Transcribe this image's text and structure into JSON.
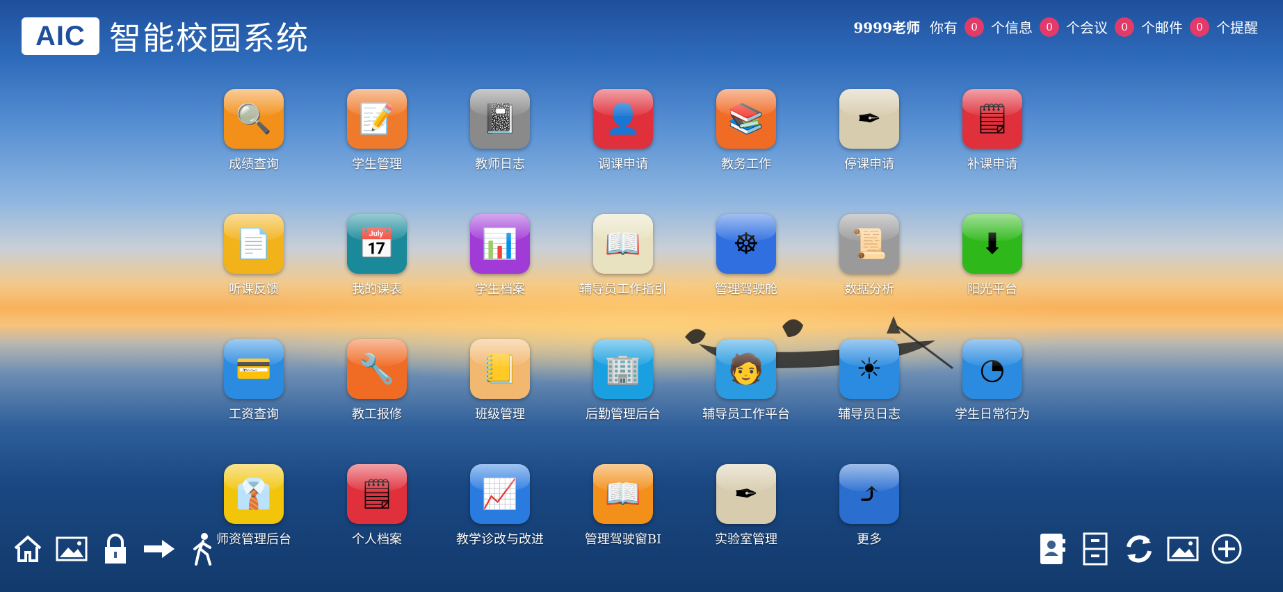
{
  "header": {
    "logo_box": "AIC",
    "logo_title": "智能校园系统"
  },
  "user": {
    "name": "9999老师",
    "you_have": "你有",
    "messages_count": "0",
    "messages_label": "个信息",
    "meetings_count": "0",
    "meetings_label": "个会议",
    "mails_count": "0",
    "mails_label": "个邮件",
    "reminders_count": "0",
    "reminders_label": "个提醒"
  },
  "apps": [
    {
      "label": "成绩查询",
      "icon": "magnifier-icon",
      "color": "#f2901a"
    },
    {
      "label": "学生管理",
      "icon": "grade-paper-icon",
      "color": "#f07a2b"
    },
    {
      "label": "教师日志",
      "icon": "notebook-pen-icon",
      "color": "#8a8a8a"
    },
    {
      "label": "调课申请",
      "icon": "user-card-icon",
      "color": "#e0303c"
    },
    {
      "label": "教务工作",
      "icon": "books-icon",
      "color": "#f06b24"
    },
    {
      "label": "停课申请",
      "icon": "pen-paper-icon",
      "color": "#d8ccae"
    },
    {
      "label": "补课申请",
      "icon": "notepad-pen-icon",
      "color": "#e0303c"
    },
    {
      "label": "听课反馈",
      "icon": "document-no-icon",
      "color": "#f2b21a"
    },
    {
      "label": "我的课表",
      "icon": "calendar-clock-icon",
      "color": "#1a8a9a"
    },
    {
      "label": "学生档案",
      "icon": "chart-presentation-icon",
      "color": "#a03bd8"
    },
    {
      "label": "辅导员工作指引",
      "icon": "lecture-book-icon",
      "color": "#e8e2c0"
    },
    {
      "label": "管理驾驶舱",
      "icon": "ship-wheel-icon",
      "color": "#2f6fe0"
    },
    {
      "label": "数据分析",
      "icon": "scroll-icon",
      "color": "#9a9a9a"
    },
    {
      "label": "阳光平台",
      "icon": "download-arrow-icon",
      "color": "#2fb81a"
    },
    {
      "label": "工资查询",
      "icon": "card-coins-icon",
      "color": "#2a8be0"
    },
    {
      "label": "教工报修",
      "icon": "tools-icon",
      "color": "#f06b24"
    },
    {
      "label": "班级管理",
      "icon": "organizer-icon",
      "color": "#f2b870"
    },
    {
      "label": "后勤管理后台",
      "icon": "building-icon",
      "color": "#1aa0e0"
    },
    {
      "label": "辅导员工作平台",
      "icon": "teacher-icon",
      "color": "#2a9be0"
    },
    {
      "label": "辅导员日志",
      "icon": "sun-icon",
      "color": "#2a8be0"
    },
    {
      "label": "学生日常行为",
      "icon": "pie-chart-icon",
      "color": "#2a8be0"
    },
    {
      "label": "师资管理后台",
      "icon": "manager-book-icon",
      "color": "#f2c40a"
    },
    {
      "label": "个人档案",
      "icon": "notepad-pen-icon",
      "color": "#e0303c"
    },
    {
      "label": "教学诊改与改进",
      "icon": "graph-report-icon",
      "color": "#2a7be0"
    },
    {
      "label": "管理驾驶窗BI",
      "icon": "open-book-icon",
      "color": "#f2901a"
    },
    {
      "label": "实验室管理",
      "icon": "pen-paper-icon",
      "color": "#d8ccae"
    },
    {
      "label": "更多",
      "icon": "arrow-ribbon-icon",
      "color": "#2a6fd0"
    }
  ],
  "dock_left": [
    {
      "name": "home-icon"
    },
    {
      "name": "image-icon"
    },
    {
      "name": "lock-icon"
    },
    {
      "name": "arrow-right-icon"
    },
    {
      "name": "walk-icon"
    }
  ],
  "dock_right": [
    {
      "name": "contacts-icon"
    },
    {
      "name": "cabinet-icon"
    },
    {
      "name": "refresh-icon"
    },
    {
      "name": "image-icon"
    },
    {
      "name": "add-circle-icon"
    }
  ]
}
